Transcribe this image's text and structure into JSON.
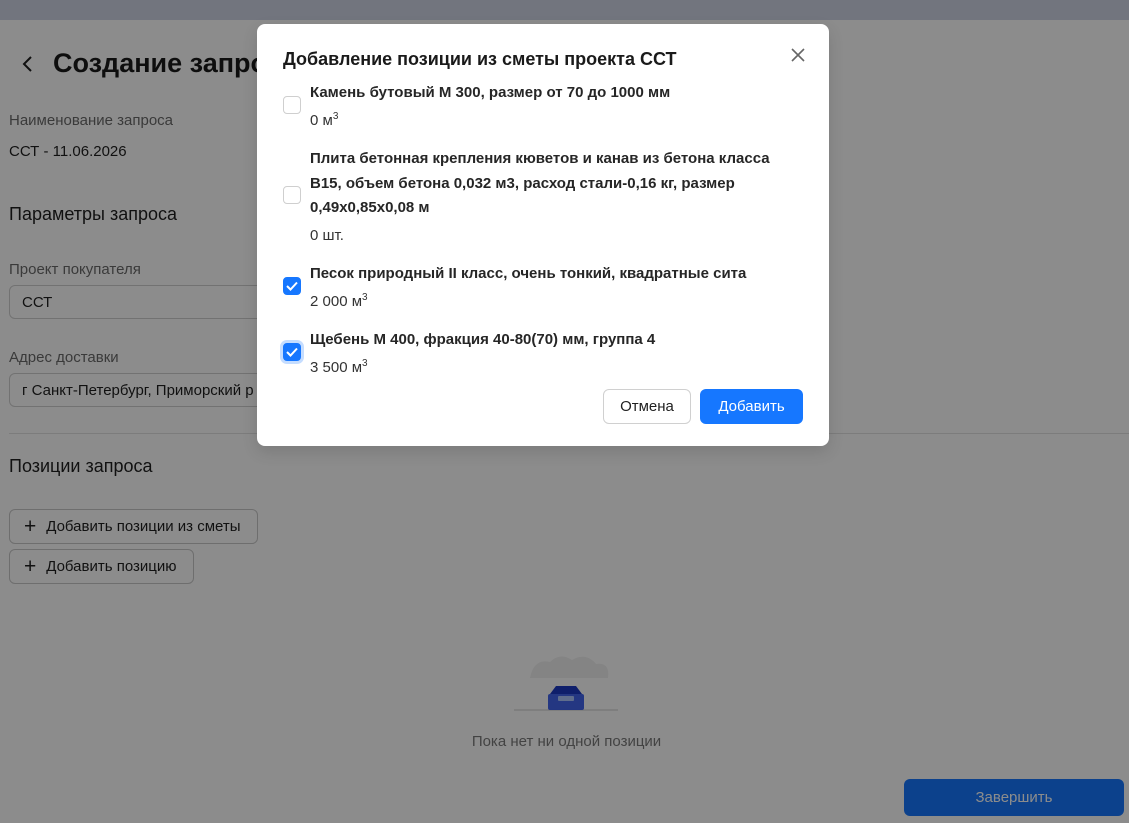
{
  "page": {
    "title": "Создание запроса",
    "name_label": "Наименование запроса",
    "name_value": "ССТ - 11.06.2026",
    "params_title": "Параметры запроса",
    "project_label": "Проект покупателя",
    "project_value": "ССТ",
    "address_label": "Адрес доставки",
    "address_value": "г Санкт-Петербург, Приморский р",
    "positions_title": "Позиции запроса",
    "add_from_estimate_label": "Добавить позиции из сметы",
    "add_position_label": "Добавить позицию",
    "plus_glyph": "+",
    "empty_text": "Пока нет ни одной позиции",
    "finish_label": "Завершить"
  },
  "modal": {
    "title": "Добавление позиции из сметы проекта ССТ",
    "items": [
      {
        "name": "Камень бутовый М 300, размер от 70 до 1000 мм",
        "qty": "0 м",
        "unit_sup": "3",
        "checked": false
      },
      {
        "name": "Плита бетонная крепления кюветов и канав из бетона класса B15, объем бетона 0,032 м3, расход стали-0,16 кг, размер 0,49х0,85х0,08 м",
        "qty": "0 шт.",
        "unit_sup": "",
        "checked": false
      },
      {
        "name": "Песок природный II класс, очень тонкий, квадратные сита",
        "qty": "2 000 м",
        "unit_sup": "3",
        "checked": true
      },
      {
        "name": "Щебень М 400, фракция 40-80(70) мм, группа 4",
        "qty": "3 500 м",
        "unit_sup": "3",
        "checked": true
      }
    ],
    "cancel_label": "Отмена",
    "add_label": "Добавить"
  },
  "colors": {
    "primary": "#1677ff",
    "overlay": "rgba(0,0,0,0.45)",
    "topbar": "#cfd6e6"
  }
}
